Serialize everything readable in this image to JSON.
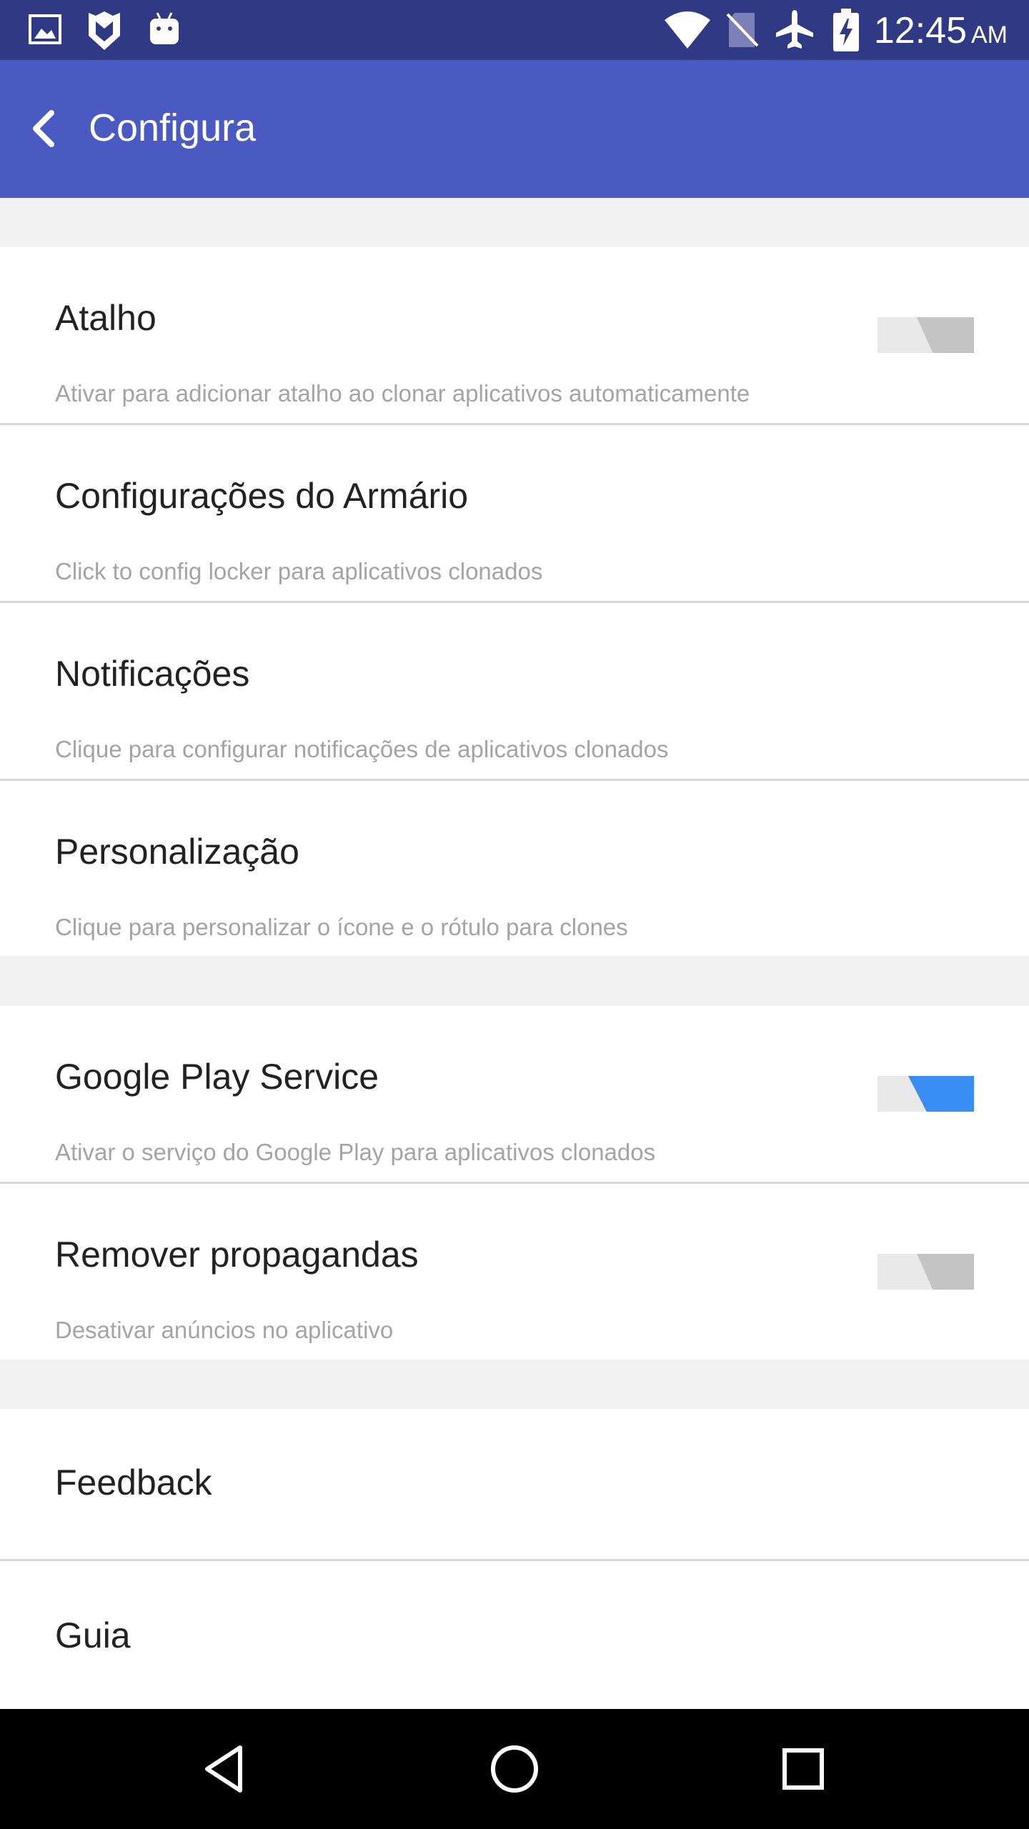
{
  "status_bar": {
    "time": "12:45",
    "ampm": "AM",
    "icons": [
      "image-icon",
      "shield-icon",
      "android-icon",
      "wifi-icon",
      "no-sim-icon",
      "airplane-icon",
      "battery-charging-icon"
    ]
  },
  "app_bar": {
    "title": "Configura",
    "back_icon": "chevron-left-icon"
  },
  "settings": {
    "shortcut": {
      "title": "Atalho",
      "subtitle": "Ativar para adicionar atalho ao clonar aplicativos automaticamente",
      "enabled": false
    },
    "locker": {
      "title": "Configurações do Armário",
      "subtitle": "Click to config locker para aplicativos clonados"
    },
    "notifications": {
      "title": "Notificações",
      "subtitle": "Clique para configurar notificações de aplicativos clonados"
    },
    "customize": {
      "title": "Personalização",
      "subtitle": "Clique para personalizar o ícone e o rótulo para clones"
    },
    "google_play": {
      "title": "Google Play Service",
      "subtitle": "Ativar o serviço do Google Play para aplicativos clonados",
      "enabled": true
    },
    "remove_ads": {
      "title": "Remover propagandas",
      "subtitle": "Desativar anúncios no aplicativo",
      "enabled": false
    },
    "feedback": {
      "title": "Feedback"
    },
    "guide": {
      "title": "Guia"
    }
  },
  "nav_bar": {
    "icons": [
      "back-triangle-icon",
      "home-circle-icon",
      "recents-square-icon"
    ]
  },
  "colors": {
    "status_bar": "#303a84",
    "app_bar": "#4a5ac2",
    "toggle_on": "#3a8df2",
    "toggle_off": "#c4c4c4"
  }
}
